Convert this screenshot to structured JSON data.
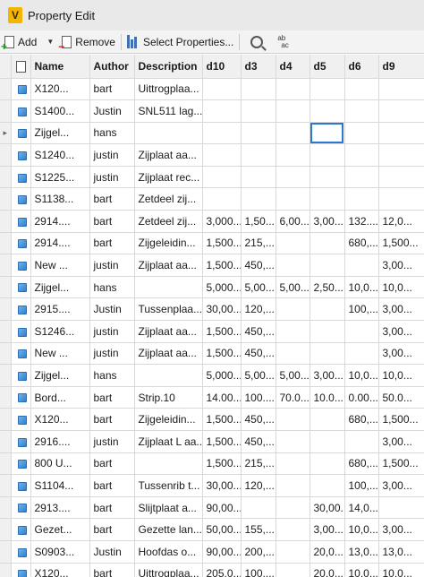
{
  "window": {
    "title": "Property Edit",
    "app_icon_letter": "V"
  },
  "toolbar": {
    "add_label": "Add",
    "remove_label": "Remove",
    "select_properties_label": "Select Properties...",
    "abac_top": "ab",
    "abac_bottom": "ac"
  },
  "current_row_marker": "▸",
  "colors": {
    "selection": "#2a78d2",
    "header_bg": "#f0f0f0",
    "cube": "#2f7fcf"
  },
  "columns": [
    "",
    "Name",
    "Author",
    "Description",
    "d10",
    "d3",
    "d4",
    "d5",
    "d6",
    "d9"
  ],
  "rows": [
    [
      "X120...",
      "bart",
      "Uittrogplaa...",
      "",
      "",
      "",
      "",
      "",
      ""
    ],
    [
      "S1400...",
      "Justin",
      "SNL511 lag...",
      "",
      "",
      "",
      "",
      "",
      ""
    ],
    [
      "Zijgel...",
      "hans",
      "",
      "",
      "",
      "",
      "",
      "",
      ""
    ],
    [
      "S1240...",
      "justin",
      "Zijplaat aa...",
      "",
      "",
      "",
      "",
      "",
      ""
    ],
    [
      "S1225...",
      "justin",
      "Zijplaat rec...",
      "",
      "",
      "",
      "",
      "",
      ""
    ],
    [
      "S1138...",
      "bart",
      "Zetdeel zij...",
      "",
      "",
      "",
      "",
      "",
      ""
    ],
    [
      "2914....",
      "bart",
      "Zetdeel zij...",
      "3,000...",
      "1,50...",
      "6,00...",
      "3,00...",
      "132....",
      "12,0..."
    ],
    [
      "2914....",
      "bart",
      "Zijgeleidin...",
      "1,500...",
      "215,...",
      "",
      "",
      "680,...",
      "1,500..."
    ],
    [
      "New ...",
      "justin",
      "Zijplaat aa...",
      "1,500...",
      "450,...",
      "",
      "",
      "",
      "3,00..."
    ],
    [
      "Zijgel...",
      "hans",
      "",
      "5,000...",
      "5,00...",
      "5,00...",
      "2,50...",
      "10,0...",
      "10,0..."
    ],
    [
      "2915....",
      "Justin",
      "Tussenplaa...",
      "30,00...",
      "120,...",
      "",
      "",
      "100,...",
      "3,00..."
    ],
    [
      "S1246...",
      "justin",
      "Zijplaat aa...",
      "1,500...",
      "450,...",
      "",
      "",
      "",
      "3,00..."
    ],
    [
      "New ...",
      "justin",
      "Zijplaat aa...",
      "1,500...",
      "450,...",
      "",
      "",
      "",
      "3,00..."
    ],
    [
      "Zijgel...",
      "hans",
      "",
      "5,000...",
      "5,00...",
      "5,00...",
      "3,00...",
      "10,0...",
      "10,0..."
    ],
    [
      "Bord...",
      "bart",
      "Strip.10",
      "14.00...",
      "100....",
      "70.0...",
      "10.0...",
      "0.00...",
      "50.0..."
    ],
    [
      "X120...",
      "bart",
      "Zijgeleidin...",
      "1,500...",
      "450,...",
      "",
      "",
      "680,...",
      "1,500..."
    ],
    [
      "2916....",
      "justin",
      "Zijplaat L aa...",
      "1,500...",
      "450,...",
      "",
      "",
      "",
      "3,00..."
    ],
    [
      "800 U...",
      "bart",
      "",
      "1,500...",
      "215,...",
      "",
      "",
      "680,...",
      "1,500..."
    ],
    [
      "S1104...",
      "bart",
      "Tussenrib t...",
      "30,00...",
      "120,...",
      "",
      "",
      "100,...",
      "3,00..."
    ],
    [
      "2913....",
      "bart",
      "Slijtplaat a...",
      "90,00...",
      "",
      "",
      "30,00...",
      "14,0...",
      ""
    ],
    [
      "Gezet...",
      "bart",
      "Gezette lan...",
      "50,00...",
      "155,...",
      "",
      "3,00...",
      "10,0...",
      "3,00..."
    ],
    [
      "S0903...",
      "Justin",
      "Hoofdas o...",
      "90,00...",
      "200,...",
      "",
      "20,0...",
      "13,0...",
      "13,0..."
    ],
    [
      "X120...",
      "bart",
      "Uittrogplaa...",
      "205,0...",
      "100,...",
      "",
      "20,0...",
      "10,0...",
      "10,0..."
    ]
  ]
}
